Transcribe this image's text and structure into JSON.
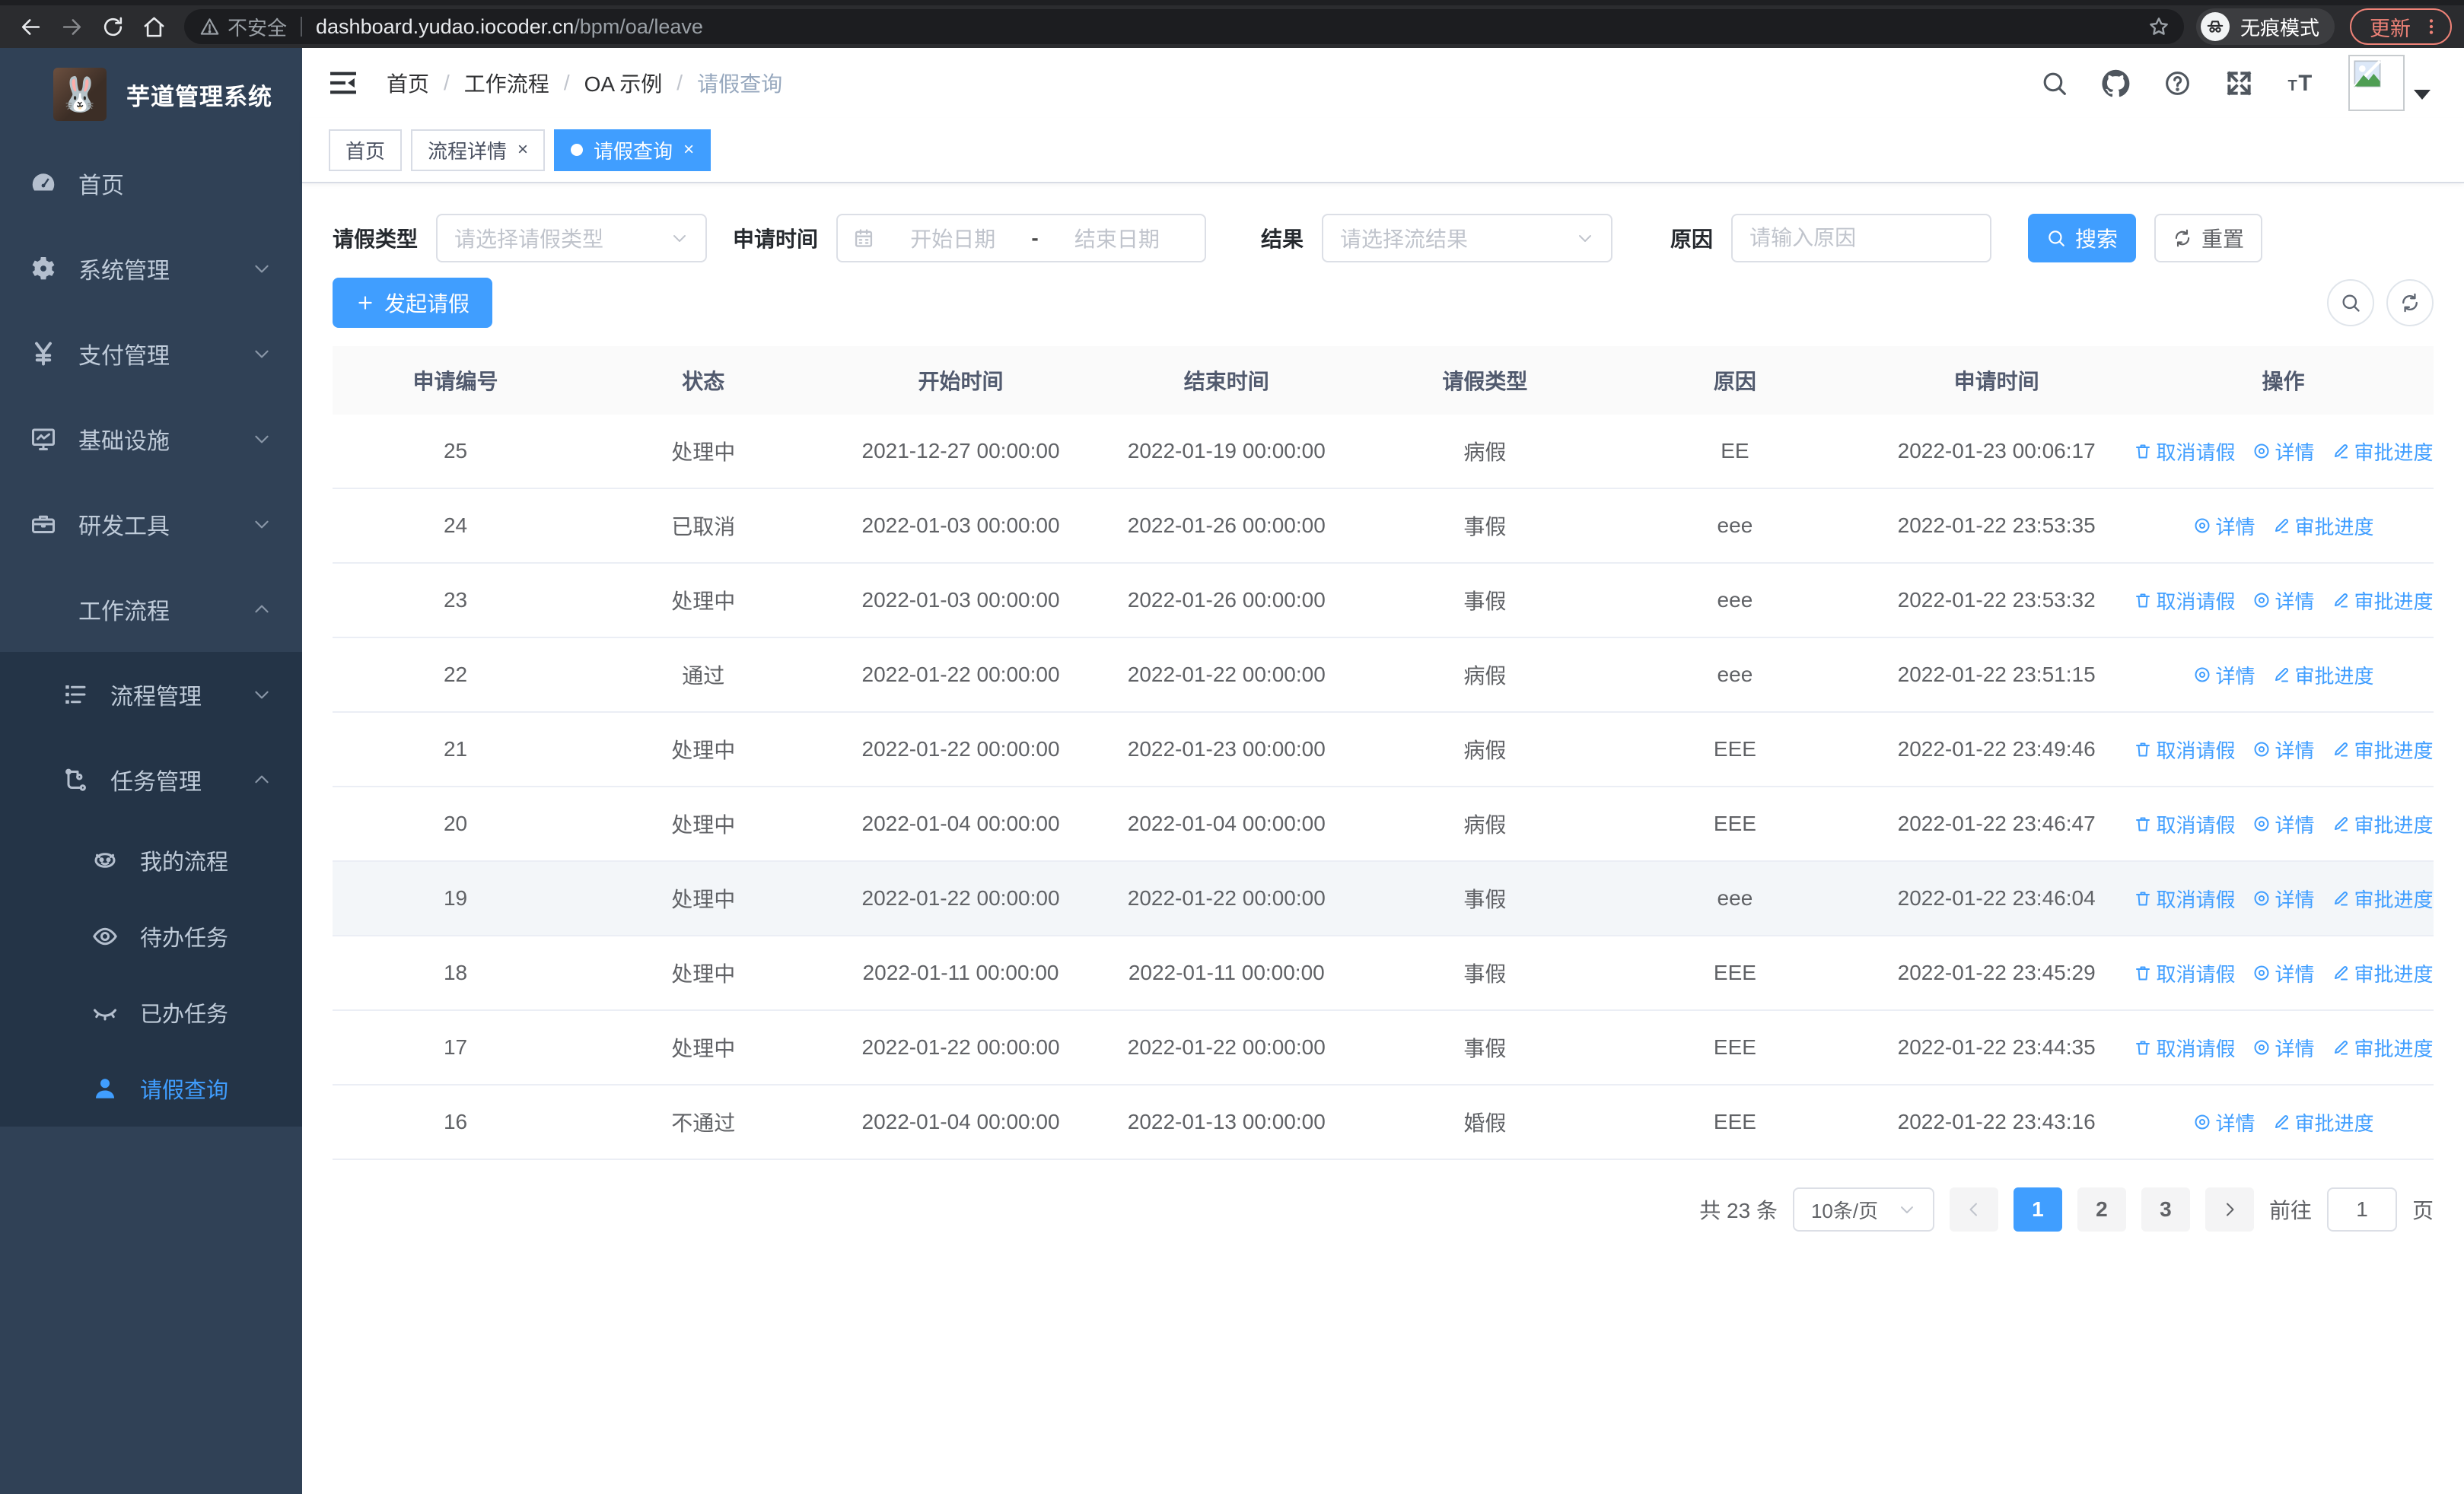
{
  "browser": {
    "security_label": "不安全",
    "url_host": "dashboard.yudao.iocoder.cn",
    "url_path": "/bpm/oa/leave",
    "incognito_label": "无痕模式",
    "update_label": "更新"
  },
  "sidebar": {
    "title": "芋道管理系统",
    "logo_emoji": "🐰",
    "items": [
      {
        "label": "首页",
        "icon": "dashboard-icon",
        "chevron": "none",
        "level": 1,
        "active": false
      },
      {
        "label": "系统管理",
        "icon": "gear-icon",
        "chevron": "down",
        "level": 1,
        "active": false
      },
      {
        "label": "支付管理",
        "icon": "yen-icon",
        "chevron": "down",
        "level": 1,
        "active": false
      },
      {
        "label": "基础设施",
        "icon": "monitor-icon",
        "chevron": "down",
        "level": 1,
        "active": false
      },
      {
        "label": "研发工具",
        "icon": "briefcase-icon",
        "chevron": "down",
        "level": 1,
        "active": false
      },
      {
        "label": "工作流程",
        "icon": "workflow-icon",
        "chevron": "up",
        "level": 1,
        "active": false
      }
    ],
    "submenu": [
      {
        "label": "流程管理",
        "icon": "process-icon",
        "chevron": "down",
        "level": 2,
        "active": false
      },
      {
        "label": "任务管理",
        "icon": "task-icon",
        "chevron": "up",
        "level": 2,
        "active": false
      },
      {
        "label": "我的流程",
        "icon": "robot-icon",
        "chevron": "none",
        "level": 3,
        "active": false
      },
      {
        "label": "待办任务",
        "icon": "eye-icon",
        "chevron": "none",
        "level": 3,
        "active": false
      },
      {
        "label": "已办任务",
        "icon": "eye-closed-icon",
        "chevron": "none",
        "level": 3,
        "active": false
      },
      {
        "label": "请假查询",
        "icon": "user-icon",
        "chevron": "none",
        "level": 3,
        "active": true
      }
    ]
  },
  "breadcrumb": [
    "首页",
    "工作流程",
    "OA 示例",
    "请假查询"
  ],
  "tabs": [
    {
      "label": "首页",
      "closable": false,
      "active": false
    },
    {
      "label": "流程详情",
      "closable": true,
      "active": false
    },
    {
      "label": "请假查询",
      "closable": true,
      "active": true
    }
  ],
  "filters": {
    "leave_type_label": "请假类型",
    "leave_type_placeholder": "请选择请假类型",
    "apply_time_label": "申请时间",
    "start_date_placeholder": "开始日期",
    "range_separator": "-",
    "end_date_placeholder": "结束日期",
    "result_label": "结果",
    "result_placeholder": "请选择流结果",
    "reason_label": "原因",
    "reason_placeholder": "请输入原因",
    "search_label": "搜索",
    "reset_label": "重置"
  },
  "toolbar": {
    "create_label": "发起请假"
  },
  "table": {
    "columns": [
      "申请编号",
      "状态",
      "开始时间",
      "结束时间",
      "请假类型",
      "原因",
      "申请时间",
      "操作"
    ],
    "action_labels": {
      "cancel": "取消请假",
      "detail": "详情",
      "progress": "审批进度"
    },
    "rows": [
      {
        "id": "25",
        "status": "处理中",
        "start": "2021-12-27 00:00:00",
        "end": "2022-01-19 00:00:00",
        "type": "病假",
        "reason": "EE",
        "apply": "2022-01-23 00:06:17",
        "actions": [
          "cancel",
          "detail",
          "progress"
        ],
        "highlight": false
      },
      {
        "id": "24",
        "status": "已取消",
        "start": "2022-01-03 00:00:00",
        "end": "2022-01-26 00:00:00",
        "type": "事假",
        "reason": "eee",
        "apply": "2022-01-22 23:53:35",
        "actions": [
          "detail",
          "progress"
        ],
        "highlight": false
      },
      {
        "id": "23",
        "status": "处理中",
        "start": "2022-01-03 00:00:00",
        "end": "2022-01-26 00:00:00",
        "type": "事假",
        "reason": "eee",
        "apply": "2022-01-22 23:53:32",
        "actions": [
          "cancel",
          "detail",
          "progress"
        ],
        "highlight": false
      },
      {
        "id": "22",
        "status": "通过",
        "start": "2022-01-22 00:00:00",
        "end": "2022-01-22 00:00:00",
        "type": "病假",
        "reason": "eee",
        "apply": "2022-01-22 23:51:15",
        "actions": [
          "detail",
          "progress"
        ],
        "highlight": false
      },
      {
        "id": "21",
        "status": "处理中",
        "start": "2022-01-22 00:00:00",
        "end": "2022-01-23 00:00:00",
        "type": "病假",
        "reason": "EEE",
        "apply": "2022-01-22 23:49:46",
        "actions": [
          "cancel",
          "detail",
          "progress"
        ],
        "highlight": false
      },
      {
        "id": "20",
        "status": "处理中",
        "start": "2022-01-04 00:00:00",
        "end": "2022-01-04 00:00:00",
        "type": "病假",
        "reason": "EEE",
        "apply": "2022-01-22 23:46:47",
        "actions": [
          "cancel",
          "detail",
          "progress"
        ],
        "highlight": false
      },
      {
        "id": "19",
        "status": "处理中",
        "start": "2022-01-22 00:00:00",
        "end": "2022-01-22 00:00:00",
        "type": "事假",
        "reason": "eee",
        "apply": "2022-01-22 23:46:04",
        "actions": [
          "cancel",
          "detail",
          "progress"
        ],
        "highlight": true
      },
      {
        "id": "18",
        "status": "处理中",
        "start": "2022-01-11 00:00:00",
        "end": "2022-01-11 00:00:00",
        "type": "事假",
        "reason": "EEE",
        "apply": "2022-01-22 23:45:29",
        "actions": [
          "cancel",
          "detail",
          "progress"
        ],
        "highlight": false
      },
      {
        "id": "17",
        "status": "处理中",
        "start": "2022-01-22 00:00:00",
        "end": "2022-01-22 00:00:00",
        "type": "事假",
        "reason": "EEE",
        "apply": "2022-01-22 23:44:35",
        "actions": [
          "cancel",
          "detail",
          "progress"
        ],
        "highlight": false
      },
      {
        "id": "16",
        "status": "不通过",
        "start": "2022-01-04 00:00:00",
        "end": "2022-01-13 00:00:00",
        "type": "婚假",
        "reason": "EEE",
        "apply": "2022-01-22 23:43:16",
        "actions": [
          "detail",
          "progress"
        ],
        "highlight": false
      }
    ]
  },
  "pagination": {
    "total_label": "共 23 条",
    "page_size": "10条/页",
    "pages": [
      "1",
      "2",
      "3"
    ],
    "active_page": "1",
    "goto_label": "前往",
    "goto_value": "1",
    "goto_suffix": "页"
  },
  "colors": {
    "primary": "#409eff",
    "sidebar_bg": "#304156",
    "sidebar_submenu_bg": "#243447",
    "update_accent": "#ee8277"
  }
}
